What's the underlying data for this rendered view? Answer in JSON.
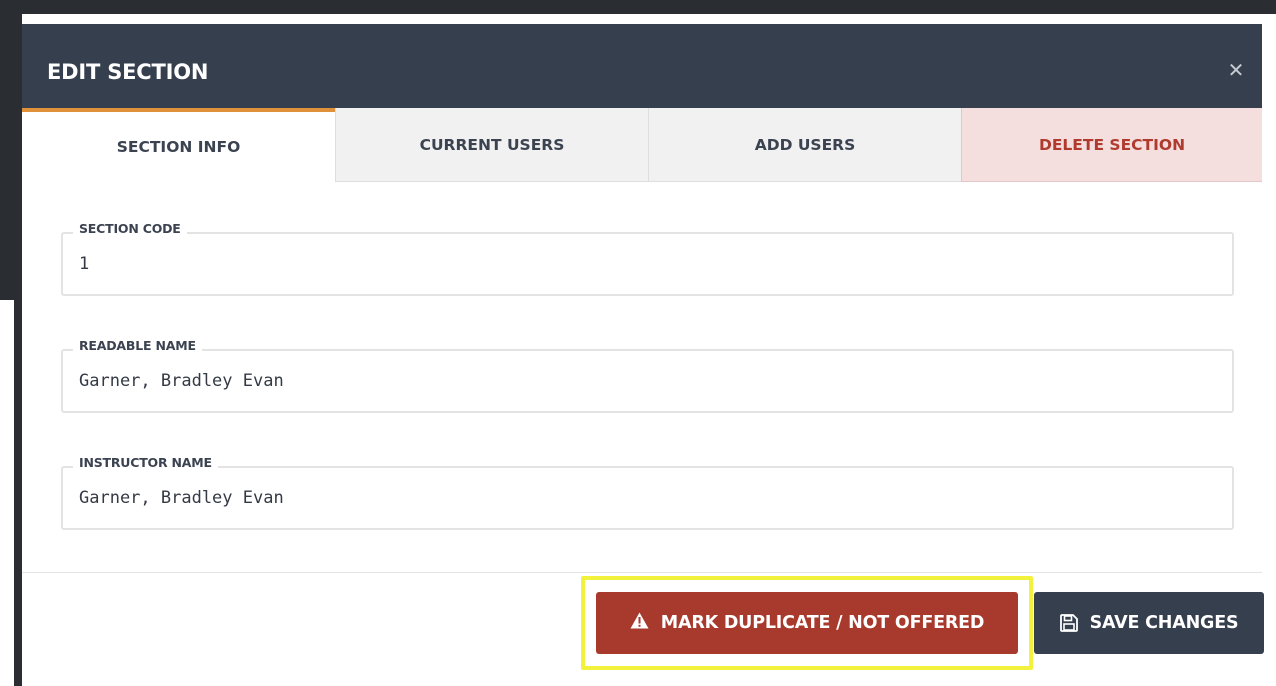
{
  "modal": {
    "title": "EDIT SECTION",
    "close_icon": "close-icon"
  },
  "tabs": [
    {
      "label": "SECTION INFO",
      "active": true
    },
    {
      "label": "CURRENT USERS",
      "active": false
    },
    {
      "label": "ADD USERS",
      "active": false
    },
    {
      "label": "DELETE SECTION",
      "active": false
    }
  ],
  "form": {
    "section_code": {
      "label": "SECTION CODE",
      "value": "1"
    },
    "readable_name": {
      "label": "READABLE NAME",
      "value": "Garner, Bradley Evan"
    },
    "instructor_name": {
      "label": "INSTRUCTOR NAME",
      "value": "Garner, Bradley Evan"
    }
  },
  "footer": {
    "mark_duplicate_label": "MARK DUPLICATE / NOT OFFERED",
    "mark_duplicate_icon": "warning-icon",
    "save_label": "SAVE CHANGES",
    "save_icon": "floppy-disk-icon"
  },
  "colors": {
    "header_bg": "#363f4e",
    "active_tab_accent": "#e0923a",
    "danger": "#a83a2d",
    "delete_tab_bg": "#f4dede",
    "highlight": "#f2f23d"
  }
}
